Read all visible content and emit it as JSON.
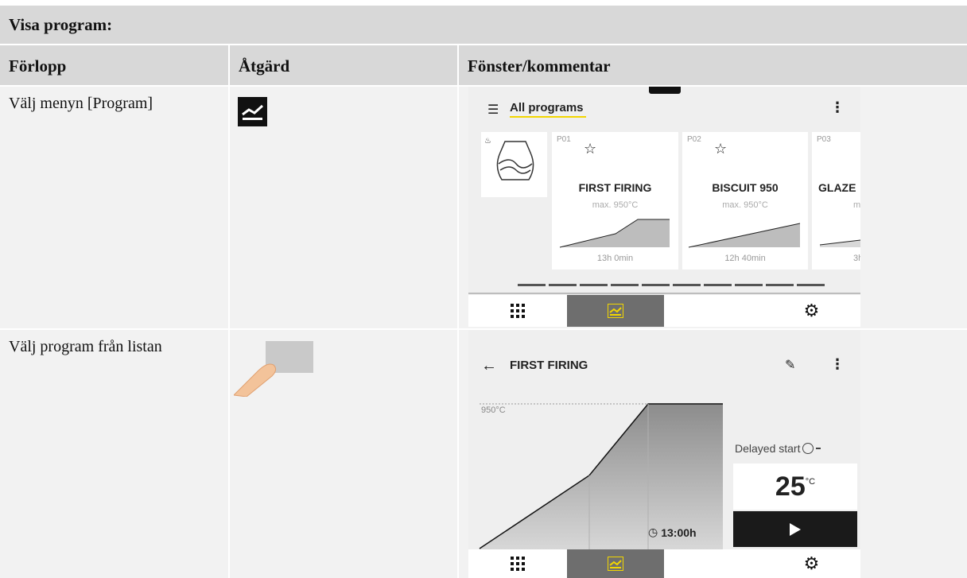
{
  "table": {
    "title": "Visa program:",
    "headers": [
      "Förlopp",
      "Åtgärd",
      "Fönster/kommentar"
    ],
    "rows": [
      {
        "step": "Välj menyn [Program]"
      },
      {
        "step": "Välj program från listan"
      }
    ]
  },
  "screen1": {
    "header_title": "All programs",
    "programs": [
      {
        "number": "P01",
        "name": "FIRST FIRING",
        "max_temp": "max. 950°C",
        "duration": "13h 0min"
      },
      {
        "number": "P02",
        "name": "BISCUIT 950",
        "max_temp": "max. 950°C",
        "duration": "12h 40min"
      },
      {
        "number": "P03",
        "name": "GLAZE",
        "max_temp": "m",
        "duration": "3h"
      }
    ],
    "page_indicator_count": 10,
    "accent_color": "#f2d600"
  },
  "screen2": {
    "header_title": "FIRST FIRING",
    "y_tick": "950°C",
    "delayed_start_label": "Delayed start",
    "temperature": "25",
    "temperature_unit": "°C",
    "duration": "13:00h"
  },
  "icons": {
    "menu": "list-icon",
    "more": "more-vertical-icon",
    "back": "arrow-left-icon",
    "edit": "pencil-icon",
    "grid": "grid-icon",
    "program": "program-curve-icon",
    "settings": "gear-icon",
    "play": "play-icon",
    "clock": "clock-icon"
  }
}
